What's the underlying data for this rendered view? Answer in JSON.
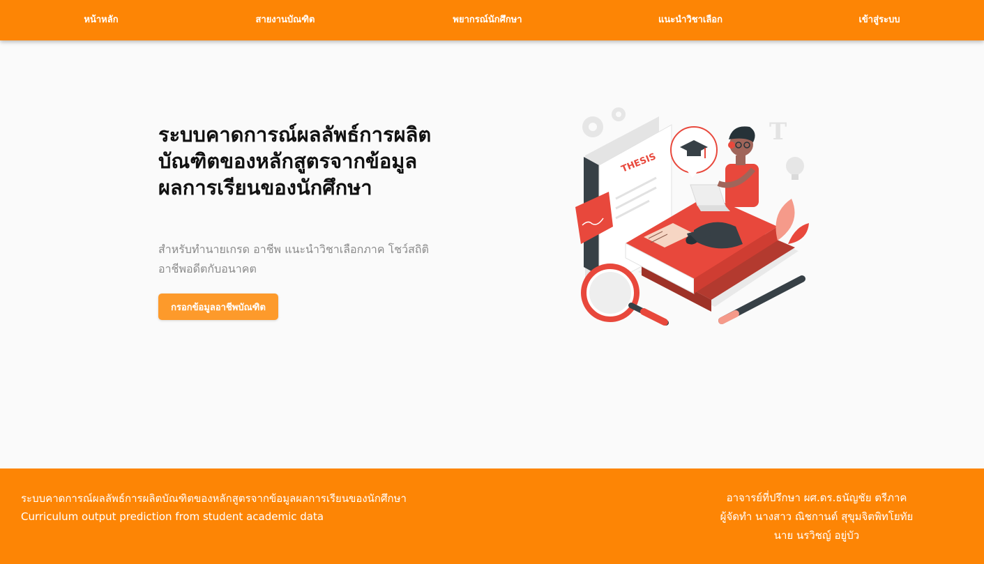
{
  "nav": {
    "items": [
      {
        "label": "หน้าหลัก"
      },
      {
        "label": "สายงานบัณฑิต"
      },
      {
        "label": "พยากรณ์นักศึกษา"
      },
      {
        "label": "แนะนำวิชาเลือก"
      },
      {
        "label": "เข้าสู่ระบบ"
      }
    ]
  },
  "hero": {
    "title": "ระบบคาดการณ์ผลลัพธ์การผลิตบัณฑิตของหลักสูตรจากข้อมูลผลการเรียนของนักศึกษา",
    "subtitle": "สำหรับทำนายเกรด อาชีพ แนะนำวิชาเลือกภาค โชว์สถิติอาชีพอดีตกับอนาคต",
    "cta_label": "กรอกข้อมูลอาชีพบัณฑิต"
  },
  "illustration": {
    "thesis_label": "THESIS",
    "letter_label": "T"
  },
  "footer": {
    "left": {
      "line1": "ระบบคาดการณ์ผลลัพธ์การผลิตบัณฑิตของหลักสูตรจากข้อมูลผลการเรียนของนักศึกษา",
      "line2": "Curriculum output prediction from student academic data"
    },
    "right": {
      "line1": "อาจารย์ที่ปรึกษา ผศ.ดร.ธนัญชัย ตรีภาค",
      "line2": "ผู้จัดทำ นางสาว ณิชกานต์ สุขุมจิตพิทโยทัย",
      "line3": "นาย นรวิชญ์ อยู่บัว"
    }
  },
  "colors": {
    "brand_orange": "#fd8505",
    "button_orange": "#fd9a2b",
    "illustration_red": "#e8483c",
    "background": "#fafafa"
  }
}
